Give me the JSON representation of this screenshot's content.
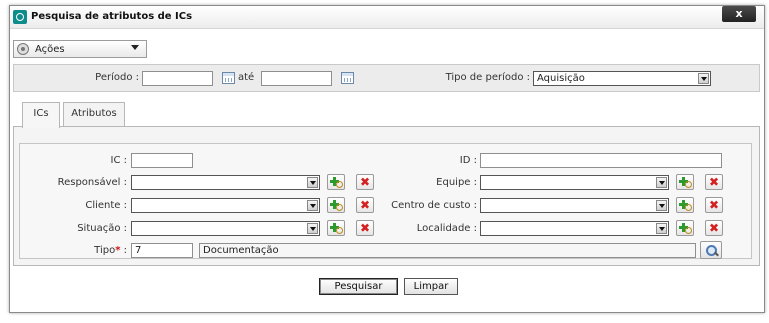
{
  "window": {
    "title": "Pesquisa de atributos de ICs",
    "close_label": "x"
  },
  "actions_menu": {
    "label": "Ações"
  },
  "period": {
    "label": "Período :",
    "from_value": "",
    "until_label": "até",
    "to_value": "",
    "type_label": "Tipo de período :",
    "type_value": "Aquisição"
  },
  "tabs": [
    {
      "label": "ICs",
      "active": true
    },
    {
      "label": "Atributos",
      "active": false
    }
  ],
  "form": {
    "ic_label": "IC :",
    "ic_value": "",
    "id_label": "ID :",
    "id_value": "",
    "responsavel_label": "Responsável :",
    "responsavel_value": "",
    "equipe_label": "Equipe :",
    "equipe_value": "",
    "cliente_label": "Cliente :",
    "cliente_value": "",
    "centro_label": "Centro de custo :",
    "centro_value": "",
    "situacao_label": "Situação :",
    "situacao_value": "",
    "localidade_label": "Localidade :",
    "localidade_value": "",
    "tipo_label": "Tipo",
    "tipo_required": "*",
    "tipo_colon": " :",
    "tipo_code": "7",
    "tipo_desc": "Documentação"
  },
  "buttons": {
    "search": "Pesquisar",
    "clear": "Limpar"
  },
  "icons": {
    "add": "add-search-icon",
    "remove": "remove-x-icon",
    "lookup": "magnifier-icon",
    "calendar": "calendar-icon",
    "gear": "gear-icon"
  },
  "colors": {
    "required": "#d01010",
    "add": "#2d9a2d",
    "remove": "#d42020",
    "title_icon": "#0e8c8c"
  }
}
